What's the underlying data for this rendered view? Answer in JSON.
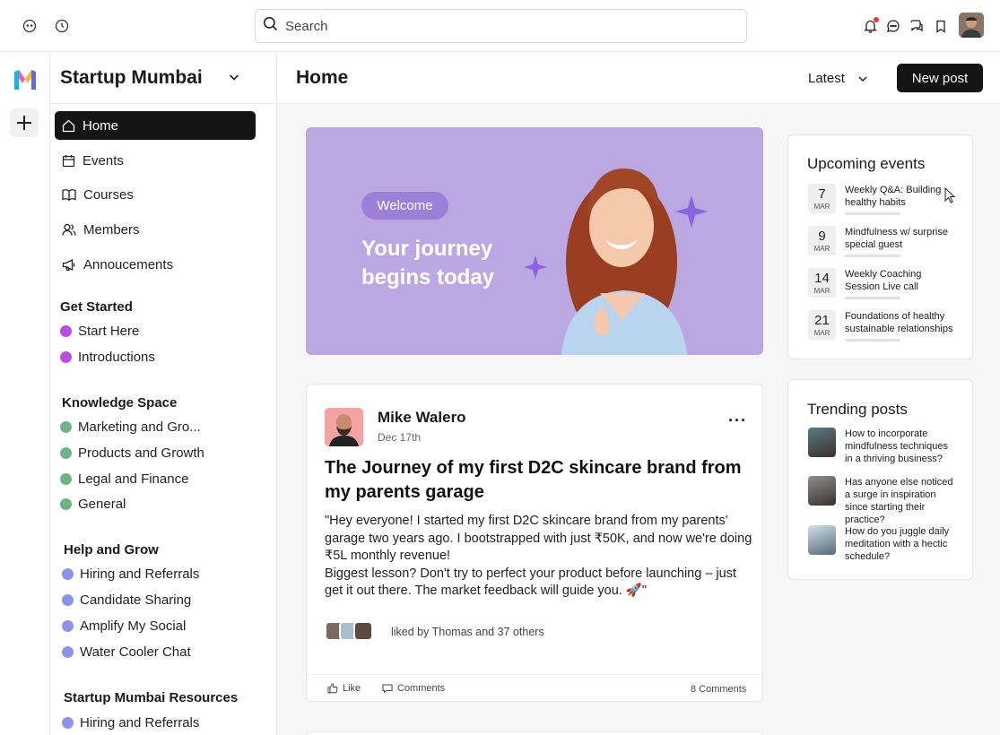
{
  "topbar": {
    "search_placeholder": "Search"
  },
  "sidebar": {
    "community_name": "Startup Mumbai",
    "nav": [
      {
        "label": "Home",
        "icon": "home-icon",
        "active": true
      },
      {
        "label": "Events",
        "icon": "calendar-icon"
      },
      {
        "label": "Courses",
        "icon": "book-icon"
      },
      {
        "label": "Members",
        "icon": "members-icon"
      },
      {
        "label": "Annoucements",
        "icon": "megaphone-icon"
      }
    ],
    "groups": [
      {
        "title": "Get Started",
        "spaces": [
          {
            "label": "Start Here",
            "color": "#b84fe0"
          },
          {
            "label": "Introductions",
            "color": "#b84fe0"
          }
        ]
      },
      {
        "title": "Knowledge Space",
        "spaces": [
          {
            "label": "Marketing and Gro...",
            "color": "#6fb387"
          },
          {
            "label": "Products and Growth",
            "color": "#6fb387"
          },
          {
            "label": "Legal and Finance",
            "color": "#6fb387"
          },
          {
            "label": "General",
            "color": "#6fb387"
          }
        ]
      },
      {
        "title": "Help and Grow",
        "spaces": [
          {
            "label": "Hiring and Referrals",
            "color": "#8c92e8"
          },
          {
            "label": "Candidate Sharing",
            "color": "#8c92e8"
          },
          {
            "label": "Amplify My Social",
            "color": "#8c92e8"
          },
          {
            "label": "Water Cooler Chat",
            "color": "#8c92e8"
          }
        ]
      },
      {
        "title": "Startup Mumbai Resources",
        "spaces": [
          {
            "label": "Hiring and Referrals",
            "color": "#8c92e8"
          }
        ]
      }
    ]
  },
  "header": {
    "title": "Home",
    "sort_label": "Latest",
    "new_post_label": "New post"
  },
  "banner": {
    "pill": "Welcome",
    "headline": "Your  journey begins today",
    "bg_color": "#bba8e3"
  },
  "post": {
    "author": "Mike Walero",
    "date": "Dec 17th",
    "title": "The Journey of my first D2C skincare brand from my parents garage",
    "body": "\"Hey everyone! I started my first D2C skincare brand from my parents' garage two years ago. I bootstrapped with just ₹50K, and now we're doing ₹5L monthly revenue!\nBiggest lesson? Don't try to perfect your product before launching – just get it out there. The market feedback will guide you. 🚀\"",
    "liked_by": "liked by Thomas and  37  others",
    "like_label": "Like",
    "comments_label": "Comments",
    "comment_count": "8 Comments"
  },
  "events": {
    "title": "Upcoming events",
    "items": [
      {
        "day": "7",
        "month": "MAR",
        "title": "Weekly Q&A: Building healthy habits"
      },
      {
        "day": "9",
        "month": "MAR",
        "title": "Mindfulness w/ surprise special guest"
      },
      {
        "day": "14",
        "month": "MAR",
        "title": "Weekly Coaching Session Live call"
      },
      {
        "day": "21",
        "month": "MAR",
        "title": "Foundations of healthy sustainable relationships"
      }
    ]
  },
  "trending": {
    "title": "Trending posts",
    "items": [
      {
        "text": "How to incorporate mindfulness techniques in a thriving business?"
      },
      {
        "text": "Has anyone else noticed a surge in inspiration since starting their practice?"
      },
      {
        "text": "How do you juggle daily meditation with a hectic schedule?"
      }
    ]
  }
}
